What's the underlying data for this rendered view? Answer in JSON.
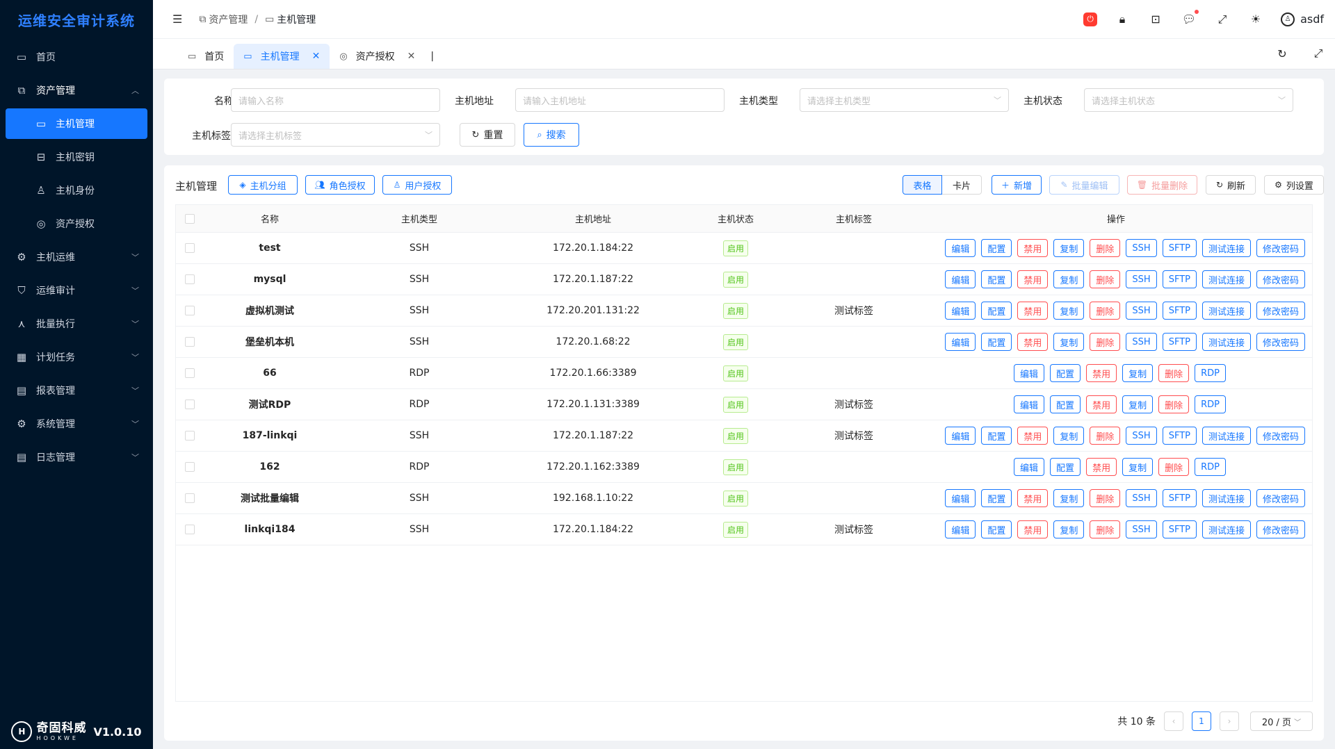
{
  "app": {
    "title": "运维安全审计系统",
    "version": "V1.0.10",
    "logo_cn": "奇固科威",
    "logo_en": "HOOKWE"
  },
  "sidebar": {
    "items": [
      {
        "label": "首页",
        "icon": "monitor-icon"
      },
      {
        "label": "资产管理",
        "icon": "assets-icon"
      },
      {
        "label": "主机管理",
        "icon": "desktop-icon"
      },
      {
        "label": "主机密钥",
        "icon": "key-icon"
      },
      {
        "label": "主机身份",
        "icon": "user-icon"
      },
      {
        "label": "资产授权",
        "icon": "shield-icon"
      },
      {
        "label": "主机运维",
        "icon": "ops-icon"
      },
      {
        "label": "运维审计",
        "icon": "audit-icon"
      },
      {
        "label": "批量执行",
        "icon": "batch-icon"
      },
      {
        "label": "计划任务",
        "icon": "calendar-icon"
      },
      {
        "label": "报表管理",
        "icon": "report-icon"
      },
      {
        "label": "系统管理",
        "icon": "system-icon"
      },
      {
        "label": "日志管理",
        "icon": "log-icon"
      }
    ]
  },
  "header": {
    "breadcrumb": [
      "资产管理",
      "主机管理"
    ],
    "separator": "/",
    "username": "asdf"
  },
  "tabs": [
    {
      "label": "首页"
    },
    {
      "label": "主机管理"
    },
    {
      "label": "资产授权"
    }
  ],
  "search": {
    "name_label": "名称",
    "name_placeholder": "请输入名称",
    "addr_label": "主机地址",
    "addr_placeholder": "请输入主机地址",
    "type_label": "主机类型",
    "type_placeholder": "请选择主机类型",
    "status_label": "主机状态",
    "status_placeholder": "请选择主机状态",
    "tag_label": "主机标签",
    "tag_placeholder": "请选择主机标签",
    "reset": "重置",
    "search": "搜索"
  },
  "toolbar": {
    "title": "主机管理",
    "group": "主机分组",
    "role_auth": "角色授权",
    "user_auth": "用户授权",
    "view_table": "表格",
    "view_card": "卡片",
    "add": "新增",
    "batch_edit": "批量编辑",
    "batch_delete": "批量删除",
    "refresh": "刷新",
    "columns": "列设置"
  },
  "table": {
    "columns": [
      "名称",
      "主机类型",
      "主机地址",
      "主机状态",
      "主机标签",
      "操作"
    ],
    "ssh_ops": [
      "编辑",
      "配置",
      "禁用",
      "复制",
      "删除",
      "SSH",
      "SFTP",
      "测试连接",
      "修改密码"
    ],
    "rdp_ops": [
      "编辑",
      "配置",
      "禁用",
      "复制",
      "删除",
      "RDP"
    ],
    "rows": [
      {
        "name": "test",
        "type": "SSH",
        "address": "172.20.1.184:22",
        "status": "启用",
        "tag": ""
      },
      {
        "name": "mysql",
        "type": "SSH",
        "address": "172.20.1.187:22",
        "status": "启用",
        "tag": ""
      },
      {
        "name": "虚拟机测试",
        "type": "SSH",
        "address": "172.20.201.131:22",
        "status": "启用",
        "tag": "测试标签"
      },
      {
        "name": "堡垒机本机",
        "type": "SSH",
        "address": "172.20.1.68:22",
        "status": "启用",
        "tag": ""
      },
      {
        "name": "66",
        "type": "RDP",
        "address": "172.20.1.66:3389",
        "status": "启用",
        "tag": ""
      },
      {
        "name": "测试RDP",
        "type": "RDP",
        "address": "172.20.1.131:3389",
        "status": "启用",
        "tag": "测试标签"
      },
      {
        "name": "187-linkqi",
        "type": "SSH",
        "address": "172.20.1.187:22",
        "status": "启用",
        "tag": "测试标签"
      },
      {
        "name": "162",
        "type": "RDP",
        "address": "172.20.1.162:3389",
        "status": "启用",
        "tag": ""
      },
      {
        "name": "测试批量编辑",
        "type": "SSH",
        "address": "192.168.1.10:22",
        "status": "启用",
        "tag": ""
      },
      {
        "name": "linkqi184",
        "type": "SSH",
        "address": "172.20.1.184:22",
        "status": "启用",
        "tag": "测试标签"
      }
    ]
  },
  "pagination": {
    "total": "共 10 条",
    "page": "1",
    "page_size": "20 / 页"
  }
}
